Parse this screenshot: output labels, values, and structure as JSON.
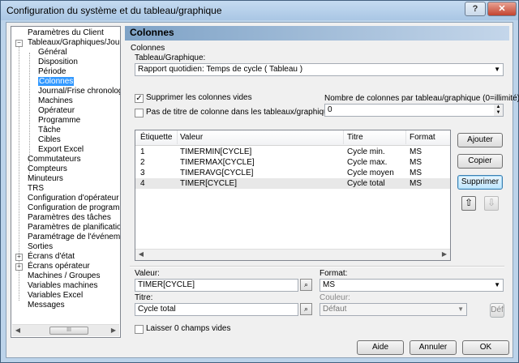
{
  "window": {
    "title": "Configuration du système et du tableau/graphique",
    "help_label": "?",
    "close_label": "✕"
  },
  "tree": {
    "items": [
      {
        "label": "Paramètres du Client"
      },
      {
        "label": "Tableaux/Graphiques/Journal"
      },
      {
        "label": "Général"
      },
      {
        "label": "Disposition"
      },
      {
        "label": "Période"
      },
      {
        "label": "Colonnes"
      },
      {
        "label": "Journal/Frise chronologique"
      },
      {
        "label": "Machines"
      },
      {
        "label": "Opérateur"
      },
      {
        "label": "Programme"
      },
      {
        "label": "Tâche"
      },
      {
        "label": "Cibles"
      },
      {
        "label": "Export Excel"
      },
      {
        "label": "Commutateurs"
      },
      {
        "label": "Compteurs"
      },
      {
        "label": "Minuteurs"
      },
      {
        "label": "TRS"
      },
      {
        "label": "Configuration d'opérateur"
      },
      {
        "label": "Configuration de programme"
      },
      {
        "label": "Paramètres des tâches"
      },
      {
        "label": "Paramètres de planification"
      },
      {
        "label": "Paramétrage de l'événement"
      },
      {
        "label": "Sorties"
      },
      {
        "label": "Écrans d'état"
      },
      {
        "label": "Écrans opérateur"
      },
      {
        "label": "Machines / Groupes"
      },
      {
        "label": "Variables machines"
      },
      {
        "label": "Variables Excel"
      },
      {
        "label": "Messages"
      }
    ],
    "selected": "Colonnes",
    "scroll_grip": "III"
  },
  "panel": {
    "title": "Colonnes",
    "group_label": "Colonnes",
    "report_label": "Tableau/Graphique:",
    "report_value": "Rapport quotidien: Temps de cycle  ( Tableau )",
    "hide_empty_label": "Supprimer les colonnes vides",
    "hide_empty_checked": true,
    "no_title_label": "Pas de titre de colonne dans les tableaux/graphiques",
    "no_title_checked": false,
    "col_count_label": "Nombre de colonnes par tableau/graphique (0=illimité):",
    "col_count_value": "0"
  },
  "table": {
    "headers": [
      "Étiquette",
      "Valeur",
      "Titre",
      "Format"
    ],
    "rows": [
      {
        "label": "1",
        "value": "TIMERMIN[CYCLE]",
        "title": "Cycle min.",
        "format": "MS"
      },
      {
        "label": "2",
        "value": "TIMERMAX[CYCLE]",
        "title": "Cycle max.",
        "format": "MS"
      },
      {
        "label": "3",
        "value": "TIMERAVG[CYCLE]",
        "title": "Cycle moyen",
        "format": "MS"
      },
      {
        "label": "4",
        "value": "TIMER[CYCLE]",
        "title": "Cycle total",
        "format": "MS"
      }
    ],
    "selected_row": 3
  },
  "side_buttons": {
    "add": "Ajouter",
    "copy": "Copier",
    "delete": "Supprimer"
  },
  "editor": {
    "value_label": "Valeur:",
    "value": "TIMER[CYCLE]",
    "title_label": "Titre:",
    "title": "Cycle total",
    "format_label": "Format:",
    "format": "MS",
    "color_label": "Couleur:",
    "color": "Défaut",
    "def_button": "Déf",
    "zero_label": "Laisser 0 champs vides",
    "zero_checked": false
  },
  "footer": {
    "help": "Aide",
    "cancel": "Annuler",
    "ok": "OK"
  },
  "colors": {
    "frame": "#bcd3ea",
    "header_start": "#7ea2c6",
    "selection": "#3399ff",
    "close": "#c3432f"
  }
}
